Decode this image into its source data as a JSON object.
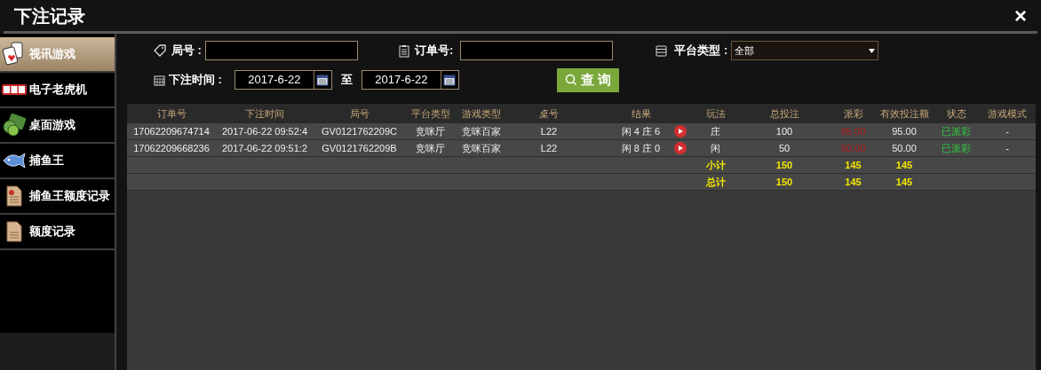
{
  "window": {
    "title": "下注记录",
    "close": "×"
  },
  "sidebar": {
    "items": [
      {
        "label": "视讯游戏",
        "kind": "cards",
        "selected": true
      },
      {
        "label": "电子老虎机",
        "kind": "slot",
        "selected": false
      },
      {
        "label": "桌面游戏",
        "kind": "money",
        "selected": false
      },
      {
        "label": "捕鱼王",
        "kind": "fish",
        "selected": false
      },
      {
        "label": "捕鱼王额度记录",
        "kind": "report",
        "selected": false
      },
      {
        "label": "额度记录",
        "kind": "document",
        "selected": false
      }
    ]
  },
  "filters": {
    "round_label": "局号 :",
    "order_label": "订单号:",
    "platform_label": "平台类型 :",
    "platform_value": "全部",
    "time_label": "下注时间 :",
    "date_from": "2017-6-22",
    "to_label": "至",
    "date_to": "2017-6-22",
    "search_button": "查 询"
  },
  "table": {
    "columns": [
      "订单号",
      "下注时间",
      "局号",
      "平台类型",
      "游戏类型",
      "桌号",
      "结果",
      "玩法",
      "总投注",
      "派彩",
      "有效投注额",
      "状态",
      "游戏模式"
    ],
    "rows": [
      {
        "kind": "bet",
        "order_no": "17062209674714",
        "bet_time": "2017-06-22 09:52:4",
        "round_no": "GV0121762209C",
        "platform": "竞咪厅",
        "game_type": "竞咪百家",
        "table_no": "L22",
        "result": "闲 4 庄 6",
        "play": "庄",
        "total_bet": "100",
        "payout": "95.00",
        "valid_bet": "95.00",
        "status": "已派彩",
        "game_mode": "-"
      },
      {
        "kind": "bet",
        "order_no": "17062209668236",
        "bet_time": "2017-06-22 09:51:2",
        "round_no": "GV0121762209B",
        "platform": "竞咪厅",
        "game_type": "竞咪百家",
        "table_no": "L22",
        "result": "闲 8 庄 0",
        "play": "闲",
        "total_bet": "50",
        "payout": "50.00",
        "valid_bet": "50.00",
        "status": "已派彩",
        "game_mode": "-"
      },
      {
        "kind": "summary",
        "label": "小计",
        "total_bet": "150",
        "payout": "145",
        "valid_bet": "145"
      },
      {
        "kind": "summary",
        "label": "总计",
        "total_bet": "150",
        "payout": "145",
        "valid_bet": "145"
      }
    ]
  }
}
